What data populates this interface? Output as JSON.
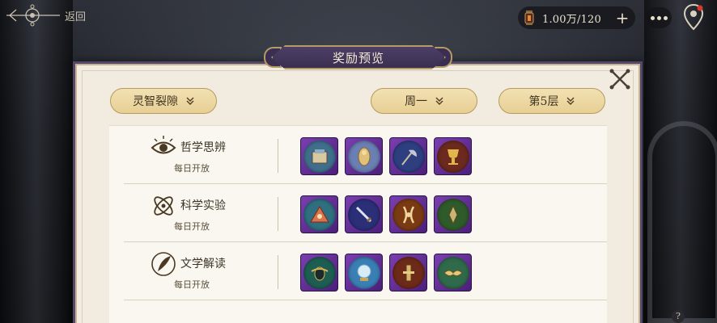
{
  "topbar": {
    "back_label": "返回",
    "currency_value": "1.00万/120",
    "plus_label": "+"
  },
  "dialog": {
    "title": "奖励预览",
    "filters": [
      {
        "label": "灵智裂隙"
      },
      {
        "label": "周一"
      },
      {
        "label": "第5层"
      }
    ]
  },
  "categories": [
    {
      "name": "哲学思辨",
      "subtitle": "每日开放",
      "icon": "eye-icon",
      "items": [
        {
          "icon": "scroll-chest-icon",
          "disc": "#3f6f8c"
        },
        {
          "icon": "golden-statue-icon",
          "disc": "#6a7fb3"
        },
        {
          "icon": "axe-icon",
          "disc": "#2e3f80"
        },
        {
          "icon": "golden-chalice-icon",
          "disc": "#6b2a1d"
        }
      ]
    },
    {
      "name": "科学实验",
      "subtitle": "每日开放",
      "icon": "atom-icon",
      "items": [
        {
          "icon": "pyramid-eye-icon",
          "disc": "#2f6f7f"
        },
        {
          "icon": "blade-icon",
          "disc": "#2b2f78"
        },
        {
          "icon": "horned-relic-icon",
          "disc": "#7a3a14"
        },
        {
          "icon": "spear-tip-icon",
          "disc": "#2f5a2a"
        }
      ]
    },
    {
      "name": "文学解读",
      "subtitle": "每日开放",
      "icon": "quill-icon",
      "items": [
        {
          "icon": "scarab-icon",
          "disc": "#1e5e52"
        },
        {
          "icon": "crystal-ball-icon",
          "disc": "#3a7fb4"
        },
        {
          "icon": "ornate-blade-icon",
          "disc": "#6d2a18"
        },
        {
          "icon": "winged-crown-icon",
          "disc": "#2f6a4a"
        }
      ]
    }
  ]
}
